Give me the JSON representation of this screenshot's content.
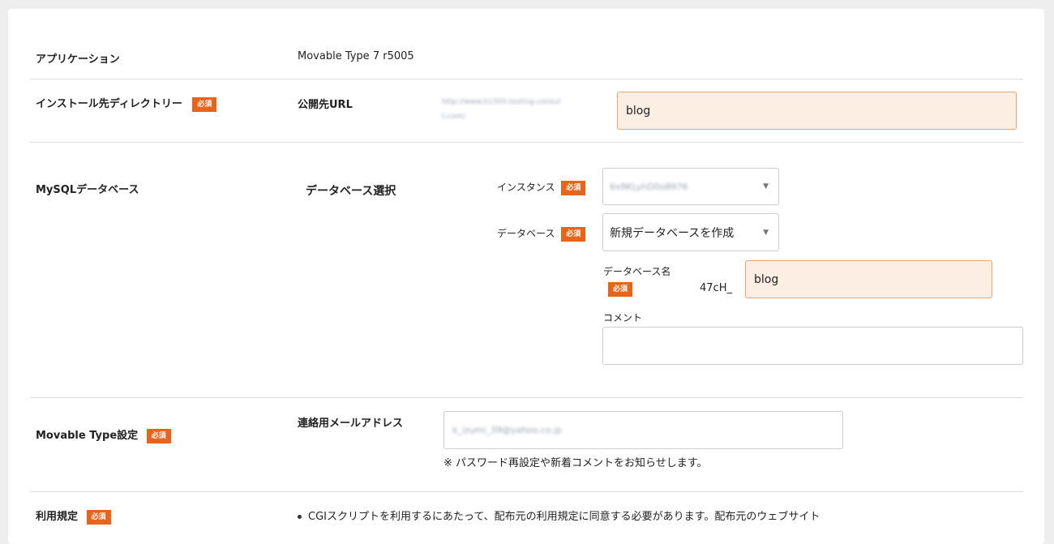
{
  "application": {
    "label": "アプリケーション",
    "value": "Movable Type 7 r5005"
  },
  "required_badge": "必須",
  "install_dir": {
    "label": "インストール先ディレクトリー",
    "field_label": "公開先URL",
    "url_prefix_line1": "http://www.k1305.testing-consul",
    "url_prefix_line2": "t.com/",
    "value": "blog"
  },
  "mysql": {
    "label": "MySQLデータベース",
    "section_label": "データベース選択",
    "instance_label": "インスタンス",
    "instance_value": "6x9KLyhD0o8976",
    "database_label": "データベース",
    "database_value": "新規データベースを作成",
    "dbname_label": "データベース名",
    "dbname_prefix": "47cH_",
    "dbname_value": "blog",
    "comment_label": "コメント",
    "comment_value": ""
  },
  "mt_settings": {
    "label": "Movable Type設定",
    "email_label": "連絡用メールアドレス",
    "email_value": "k_izumi_39@yahoo.co.jp",
    "email_note": "※ パスワード再設定や新着コメントをお知らせします。"
  },
  "terms": {
    "label": "利用規定",
    "bullet_text": "CGIスクリプトを利用するにあたって、配布元の利用規定に同意する必要があります。配布元のウェブサイト"
  }
}
